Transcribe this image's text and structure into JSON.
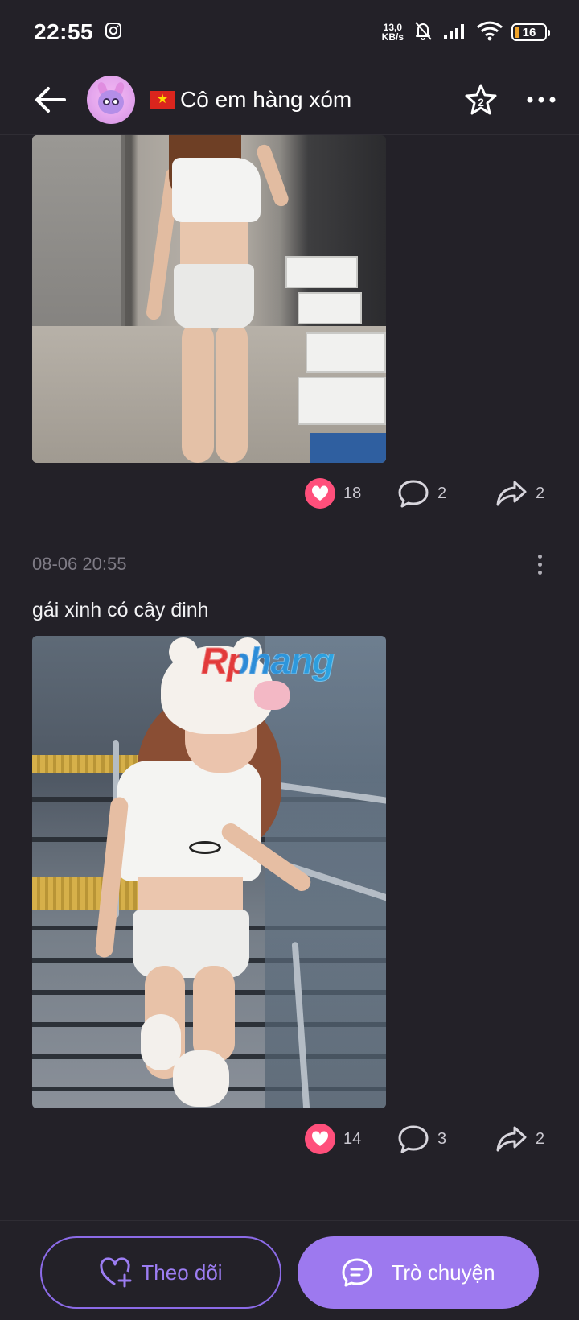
{
  "status_bar": {
    "time": "22:55",
    "net_speed_value": "13,0",
    "net_speed_unit": "KB/s",
    "battery": "16"
  },
  "header": {
    "flag": "vietnam-flag-icon",
    "title": "Cô em hàng xóm",
    "favorite_icon": "star-badge-icon",
    "favorite_badge": "2"
  },
  "posts": [
    {
      "image": "photo-woman-in-shoe-store",
      "likes": "18",
      "comments": "2",
      "shares": "2"
    },
    {
      "time": "08-06 20:55",
      "caption": "gái xinh có cây đinh",
      "image": "photo-woman-on-stairs",
      "watermark": "Rphang",
      "likes": "14",
      "comments": "3",
      "shares": "2"
    }
  ],
  "bottom_bar": {
    "follow_label": "Theo dõi",
    "chat_label": "Trò chuyện"
  },
  "colors": {
    "background": "#232128",
    "accent": "#9d79ef",
    "like": "#ff4f7b"
  }
}
